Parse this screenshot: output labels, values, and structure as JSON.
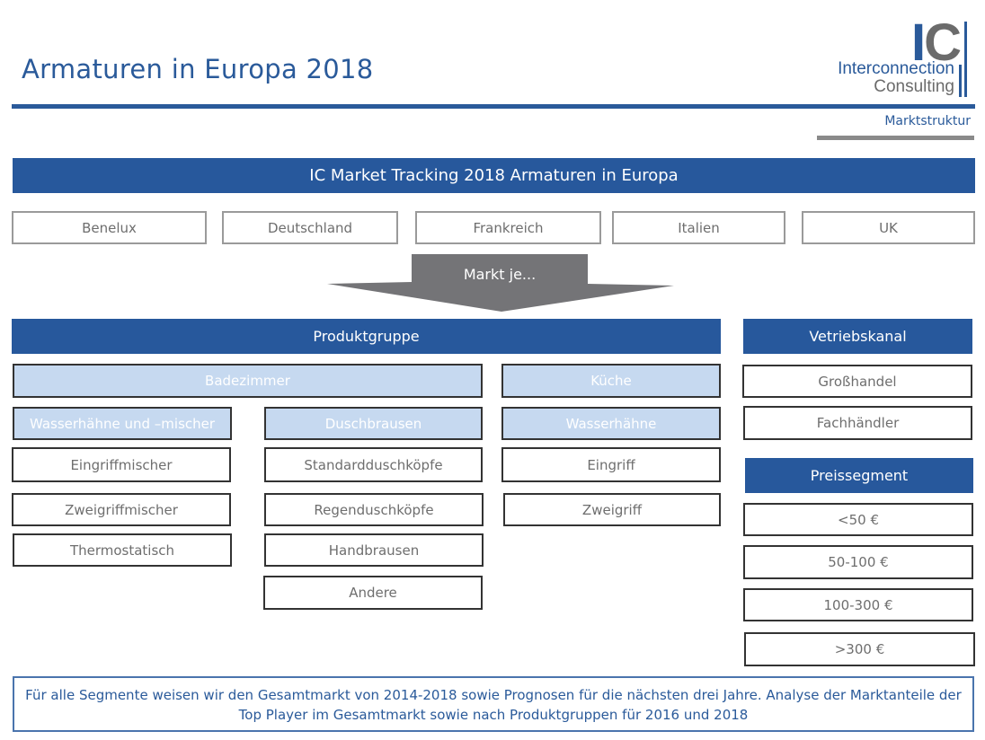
{
  "header": {
    "title": "Armaturen in Europa 2018",
    "section": "Marktstruktur",
    "logo": {
      "mark_i": "I",
      "mark_c": "C",
      "line1": "Interconnection",
      "line2": "Consulting"
    }
  },
  "main_banner": "IC Market Tracking 2018 Armaturen in Europa",
  "regions": [
    "Benelux",
    "Deutschland",
    "Frankreich",
    "Italien",
    "UK"
  ],
  "arrow_label": "Markt je...",
  "produktgruppe": {
    "header": "Produktgruppe",
    "badezimmer": {
      "label": "Badezimmer",
      "wasserhaehne": {
        "label": "Wasserhähne und –mischer",
        "items": [
          "Eingriffmischer",
          "Zweigriffmischer",
          "Thermostatisch"
        ]
      },
      "duschbrausen": {
        "label": "Duschbrausen",
        "items": [
          "Standardduschköpfe",
          "Regenduschköpfe",
          "Handbrausen",
          "Andere"
        ]
      }
    },
    "kueche": {
      "label": "Küche",
      "wasserhaehne": {
        "label": "Wasserhähne",
        "items": [
          "Eingriff",
          "Zweigriff"
        ]
      }
    }
  },
  "vertriebskanal": {
    "header": "Vetriebskanal",
    "items": [
      "Großhandel",
      "Fachhändler"
    ]
  },
  "preissegment": {
    "header": "Preissegment",
    "items": [
      "<50 €",
      "50-100 €",
      "100-300 €",
      ">300 €"
    ]
  },
  "footer_text": "Für alle Segmente weisen wir den Gesamtmarkt von 2014-2018 sowie Prognosen für die nächsten drei Jahre. Analyse der Marktanteile der Top Player im Gesamtmarkt sowie nach Produktgruppen für 2016 und 2018",
  "colors": {
    "brand_blue": "#27589c",
    "light_blue": "#c6d9f0",
    "arrow_grey": "#747477",
    "text_grey": "#6e6e6e"
  }
}
